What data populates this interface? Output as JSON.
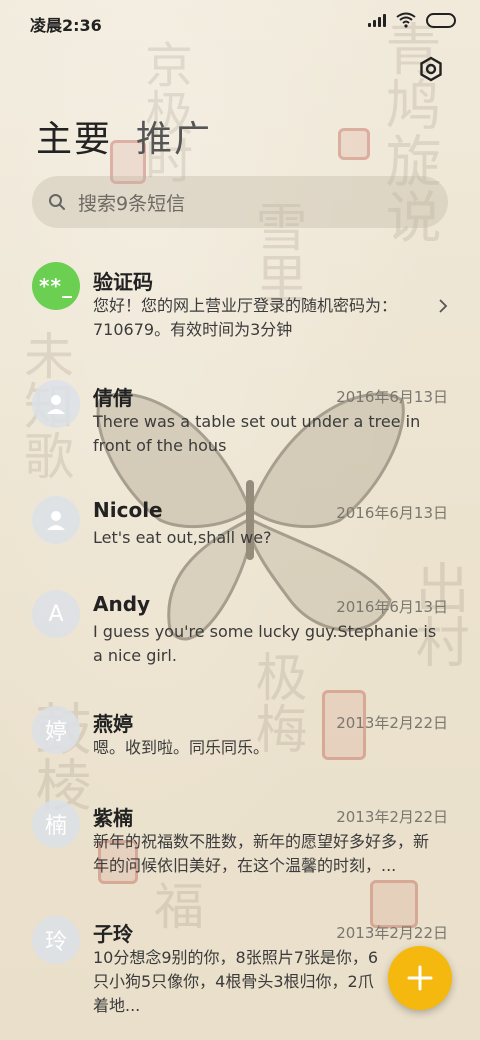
{
  "status_bar": {
    "time": "凌晨2:36"
  },
  "tabs": [
    {
      "label": "主要",
      "active": true
    },
    {
      "label": "推广",
      "active": false
    }
  ],
  "search": {
    "placeholder": "搜索9条短信"
  },
  "conversations": [
    {
      "name": "验证码",
      "avatar": "**_",
      "avatar_color": "#6bcf52",
      "date": "",
      "preview": "您好！您的网上营业厅登录的随机密码为：710679。有效时间为3分钟"
    },
    {
      "name": "倩倩",
      "avatar": "person-icon",
      "date": "2016年6月13日",
      "preview": "There was a table set out under a tree in front of the hous"
    },
    {
      "name": "Nicole",
      "avatar": "person-icon",
      "date": "2016年6月13日",
      "preview": "Let's eat out,shall we?"
    },
    {
      "name": "Andy",
      "avatar": "A",
      "date": "2016年6月13日",
      "preview": "I guess you're some lucky guy.Stephanie is a nice girl."
    },
    {
      "name": "燕婷",
      "avatar": "婷",
      "date": "2013年2月22日",
      "preview": "嗯。收到啦。同乐同乐。"
    },
    {
      "name": "紫楠",
      "avatar": "楠",
      "date": "2013年2月22日",
      "preview": "新年的祝福数不胜数，新年的愿望好多好多，新年的问候依旧美好，在这个温馨的时刻，..."
    },
    {
      "name": "子玲",
      "avatar": "玲",
      "date": "2013年2月22日",
      "preview": "10分想念9别的你，8张照片7张是你，6只小狗5只像你，4根骨头3根归你，2爪着地..."
    }
  ],
  "colors": {
    "accent": "#f5b80f",
    "verify_avatar": "#6bcf52"
  },
  "icons": {
    "settings": "gear-icon",
    "search": "search-icon",
    "compose": "plus-icon"
  }
}
